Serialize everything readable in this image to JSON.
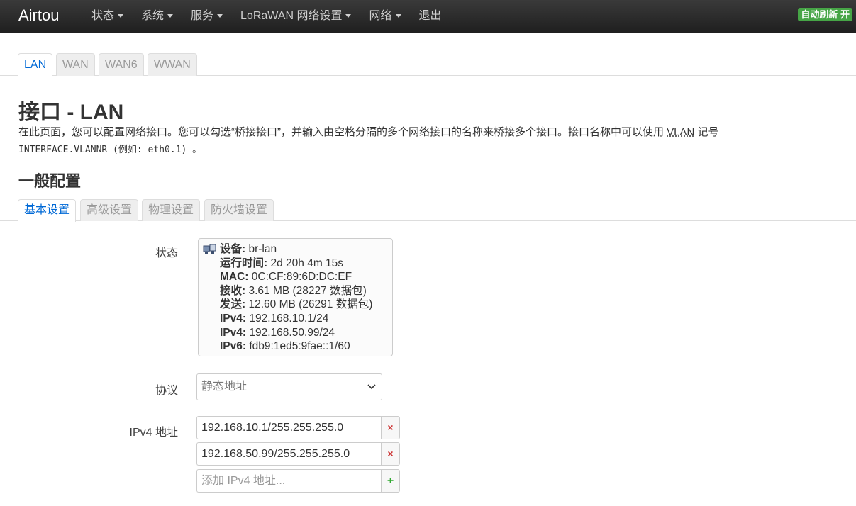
{
  "header": {
    "brand": "Airtou",
    "menu": [
      {
        "label": "状态",
        "dropdown": true
      },
      {
        "label": "系统",
        "dropdown": true
      },
      {
        "label": "服务",
        "dropdown": true
      },
      {
        "label": "LoRaWAN 网络设置",
        "dropdown": true
      },
      {
        "label": "网络",
        "dropdown": true
      },
      {
        "label": "退出",
        "dropdown": false
      }
    ],
    "refresh_badge": "自动刷新 开",
    "badge_color": "#46a546"
  },
  "iface_tabs": [
    "LAN",
    "WAN",
    "WAN6",
    "WWAN"
  ],
  "page": {
    "title": "接口 - LAN",
    "desc_part1": "在此页面，您可以配置网络接口。您可以勾选“桥接接口”，并输入由空格分隔的多个网络接口的名称来桥接多个接口。接口名称中可以使用 ",
    "desc_abbr": "VLAN",
    "desc_part2": " 记号",
    "desc_code": "INTERFACE.VLANNR",
    "desc_part3": " (例如: ",
    "desc_example": "eth0.1",
    "desc_part4": ") 。",
    "section_title": "一般配置"
  },
  "config_tabs": [
    "基本设置",
    "高级设置",
    "物理设置",
    "防火墙设置"
  ],
  "status": {
    "label": "状态",
    "icon": "ethernet-icon",
    "lines": [
      {
        "key": "设备:",
        "value": " br-lan"
      },
      {
        "key": "运行时间:",
        "value": " 2d 20h 4m 15s"
      },
      {
        "key": "MAC:",
        "value": " 0C:CF:89:6D:DC:EF"
      },
      {
        "key": "接收:",
        "value": " 3.61 MB (28227 数据包)"
      },
      {
        "key": "发送:",
        "value": " 12.60 MB (26291 数据包)"
      },
      {
        "key": "IPv4:",
        "value": " 192.168.10.1/24"
      },
      {
        "key": "IPv4:",
        "value": " 192.168.50.99/24"
      },
      {
        "key": "IPv6:",
        "value": " fdb9:1ed5:9fae::1/60"
      }
    ]
  },
  "protocol": {
    "label": "协议",
    "selected": "静态地址"
  },
  "ipv4": {
    "label": "IPv4 地址",
    "values": [
      "192.168.10.1/255.255.255.0",
      "192.168.50.99/255.255.255.0"
    ],
    "placeholder": "添加 IPv4 地址...",
    "remove_glyph": "×",
    "add_glyph": "+"
  }
}
